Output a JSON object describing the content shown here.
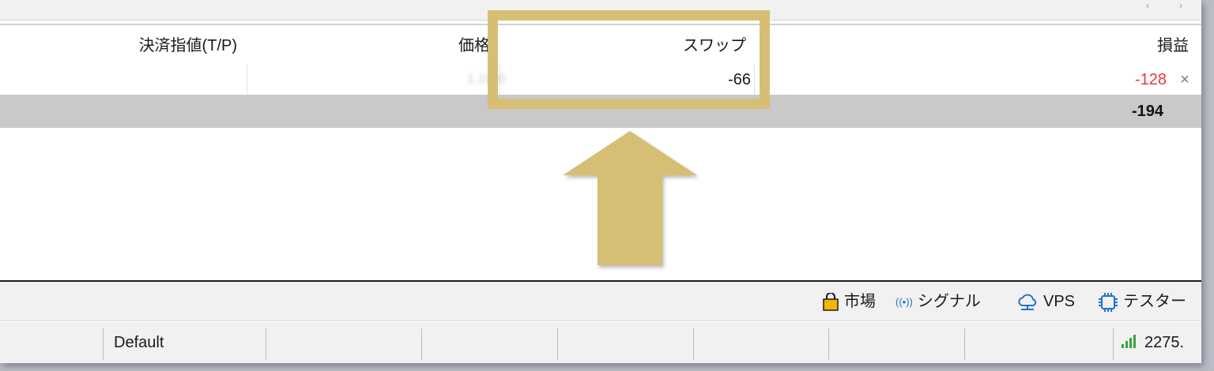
{
  "columns": {
    "take_profit": "決済指値(T/P)",
    "price": "価格",
    "swap": "スワップ",
    "profit": "損益"
  },
  "position_row": {
    "price": "1.1000",
    "swap": "-66",
    "profit": "-128",
    "close_icon": "×"
  },
  "total_row": {
    "profit": "-194"
  },
  "toolbar": {
    "market_label": "市場",
    "signal_icon": "((•))",
    "signal_label": "シグナル",
    "vps_label": "VPS",
    "tester_label": "テスター"
  },
  "statusbar": {
    "profile": "Default",
    "connection": "2275."
  },
  "nav": {
    "left": "‹",
    "right": "›"
  },
  "colors": {
    "highlight": "#d6bf74",
    "loss": "#e8383b",
    "signal_green": "#3aa63a",
    "icon_blue": "#1f74c7",
    "market_yellow": "#f2b705"
  },
  "icons": [
    "shopping-bag-icon",
    "signal-broadcast-icon",
    "cloud-icon",
    "chip-icon",
    "signal-bars-icon",
    "close-icon",
    "up-arrow-icon"
  ]
}
